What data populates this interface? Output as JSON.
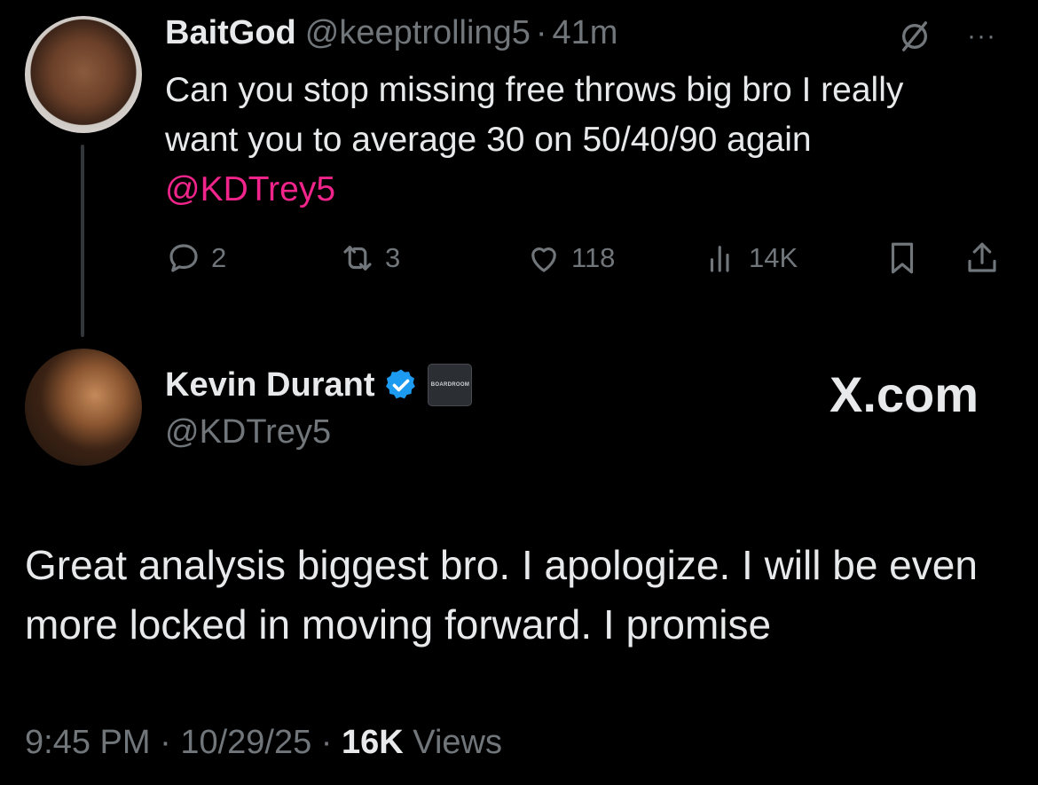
{
  "tweet": {
    "author_name": "BaitGod",
    "handle": "@keeptrolling5",
    "separator": "·",
    "time": "41m",
    "text_line1": "Can you stop missing free throws big bro I really",
    "text_line2": "want you to average 30 on 50/40/90 again",
    "mention": "@KDTrey5",
    "actions": {
      "replies": "2",
      "reposts": "3",
      "likes": "118",
      "views": "14K"
    },
    "more_label": "···"
  },
  "reply": {
    "author_name": "Kevin Durant",
    "handle": "@KDTrey5",
    "affiliation_label": "BOARDROOM",
    "watermark": "X.com",
    "text": "Great analysis biggest bro. I apologize. I will be even more locked in moving forward. I promise",
    "time": "9:45 PM",
    "separator1": "·",
    "date": "10/29/25",
    "separator2": "·",
    "views_count": "16K",
    "views_label": "Views"
  },
  "colors": {
    "background": "#000000",
    "text": "#e7e9ea",
    "muted": "#71767b",
    "mention": "#f0248a",
    "verified": "#1d9bf0"
  },
  "icons": [
    "grok-icon",
    "more-icon",
    "reply-icon",
    "repost-icon",
    "like-icon",
    "views-icon",
    "bookmark-icon",
    "share-icon",
    "verified-icon"
  ]
}
